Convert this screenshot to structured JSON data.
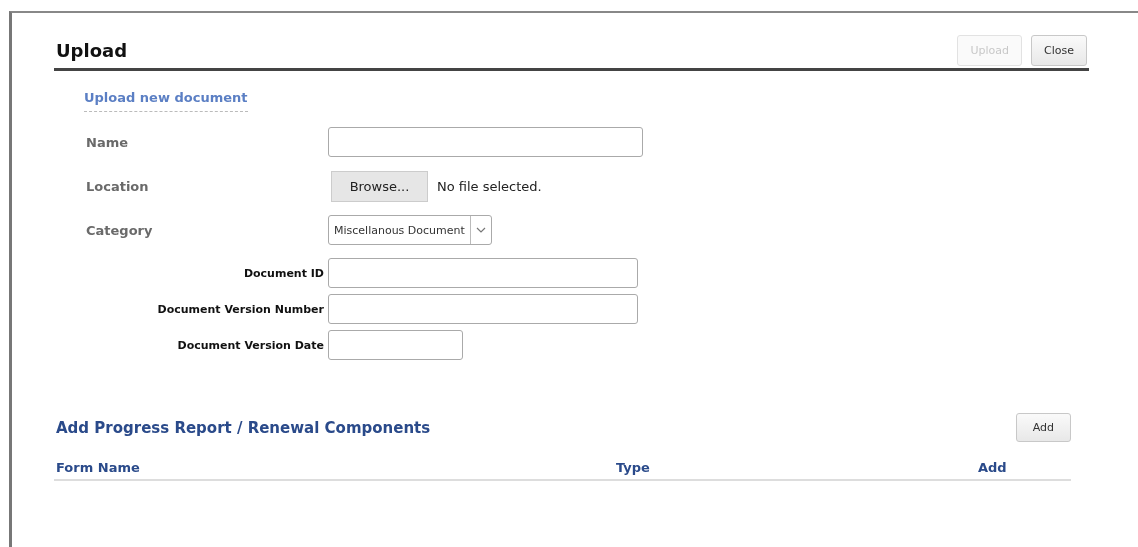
{
  "dialog": {
    "title": "Upload",
    "buttons": [
      {
        "label": "Upload",
        "disabled": true
      },
      {
        "label": "Close",
        "disabled": false
      }
    ]
  },
  "upload_section": {
    "title": "Upload new document",
    "fields": [
      {
        "kind": "text",
        "label": "Name"
      },
      {
        "kind": "file",
        "label": "Location",
        "button": "Browse...",
        "status": "No file selected."
      },
      {
        "kind": "select",
        "label": "Category",
        "value": "Miscellanous Document"
      }
    ],
    "document_fields": [
      {
        "label": "Document ID"
      },
      {
        "label": "Document Version Number"
      },
      {
        "label": "Document Version Date"
      }
    ]
  },
  "components_section": {
    "title": "Add Progress Report / Renewal  Components",
    "button": {
      "label": "Add",
      "disabled": false
    },
    "table": {
      "columns": [
        "Form Name",
        "Type",
        "Add"
      ]
    }
  }
}
